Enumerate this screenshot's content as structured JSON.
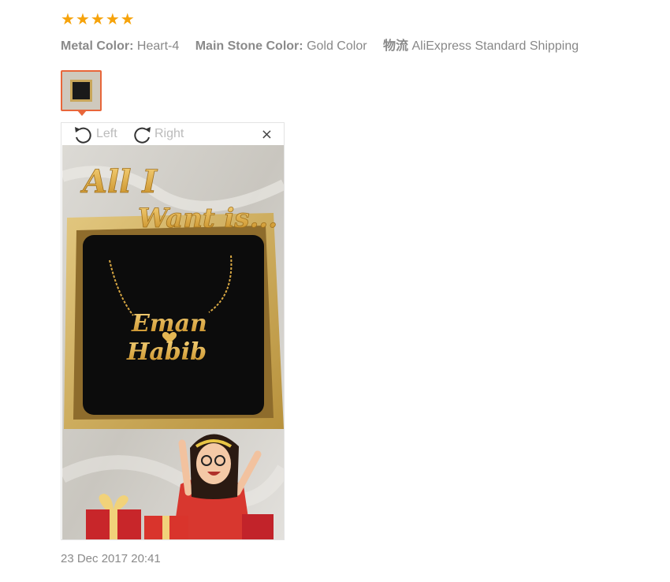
{
  "review": {
    "stars": [
      "★",
      "★",
      "★",
      "★",
      "★"
    ],
    "attributes": [
      {
        "key": "Metal Color:",
        "value": "Heart-4"
      },
      {
        "key": "Main Stone Color:",
        "value": "Gold Color"
      },
      {
        "key": "物流",
        "value": "AliExpress Standard Shipping"
      }
    ],
    "date": "23 Dec 2017 20:41"
  },
  "viewer": {
    "rotate_left_label": "Left",
    "rotate_right_label": "Right",
    "close_glyph": "×",
    "photo_text": {
      "heading_line1": "All I",
      "heading_line2": "Want is...",
      "name_line1": "Eman",
      "name_line2": "Habib"
    }
  },
  "colors": {
    "star": "#f6a30b",
    "thumb_border": "#e8663a",
    "gold": "#d9a843"
  }
}
